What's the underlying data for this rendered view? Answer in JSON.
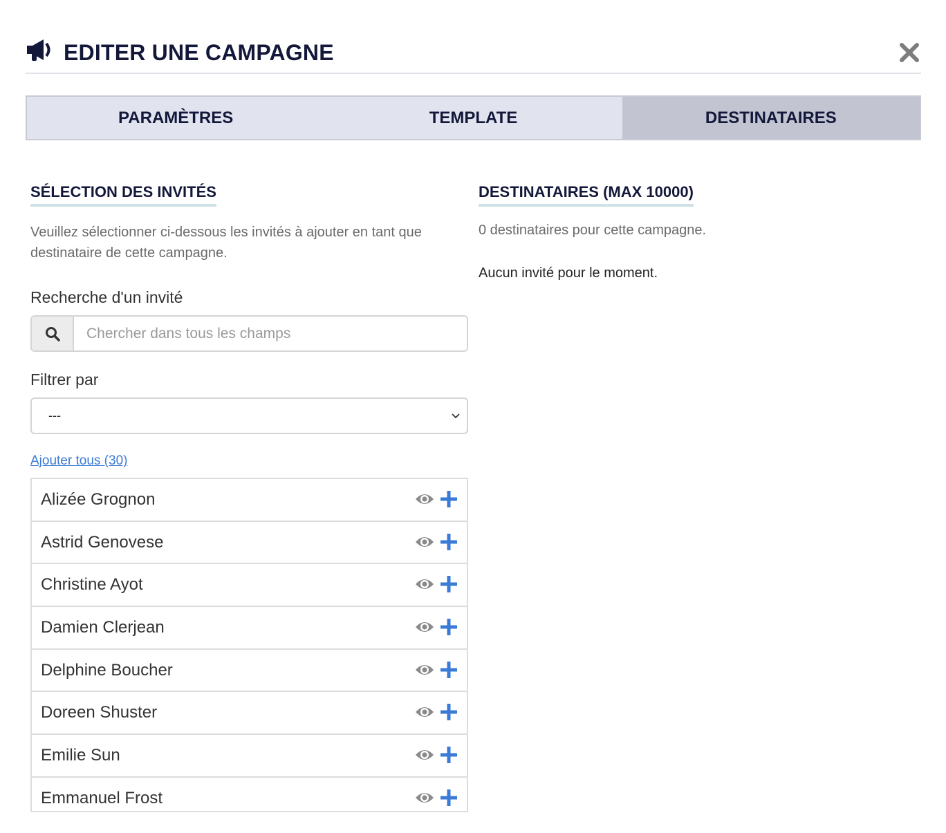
{
  "modal": {
    "title": "EDITER UNE CAMPAGNE"
  },
  "tabs": [
    {
      "label": "PARAMÈTRES",
      "active": false
    },
    {
      "label": "TEMPLATE",
      "active": false
    },
    {
      "label": "DESTINATAIRES",
      "active": true
    }
  ],
  "selection": {
    "title": "SÉLECTION DES INVITÉS",
    "description": "Veuillez sélectionner ci-dessous les invités à ajouter en tant que destinataire de cette campagne.",
    "search_label": "Recherche d'un invité",
    "search_value": "",
    "search_placeholder": "Chercher dans tous les champs",
    "filter_label": "Filtrer par",
    "filter_value": "---",
    "add_all_label": "Ajouter tous (30)",
    "guests": [
      "Alizée Grognon",
      "Astrid Genovese",
      "Christine Ayot",
      "Damien Clerjean",
      "Delphine Boucher",
      "Doreen Shuster",
      "Emilie Sun",
      "Emmanuel Frost"
    ]
  },
  "recipients": {
    "title": "DESTINATAIRES (MAX 10000)",
    "count_text": "0 destinataires pour cette campagne.",
    "empty_text": "Aucun invité pour le moment."
  },
  "icons": {
    "header": "megaphone-icon",
    "close": "close-icon",
    "search": "search-icon",
    "view": "eye-icon",
    "add": "plus-icon",
    "dropdown": "chevron-down-icon"
  },
  "colors": {
    "title": "#13183a",
    "tab_bg": "#e1e3ee",
    "tab_active_bg": "#c2c4d2",
    "link": "#3a7bd5",
    "plus": "#3a7bd5",
    "eye": "#8a8a8a",
    "underline": "#cfe2e8"
  }
}
